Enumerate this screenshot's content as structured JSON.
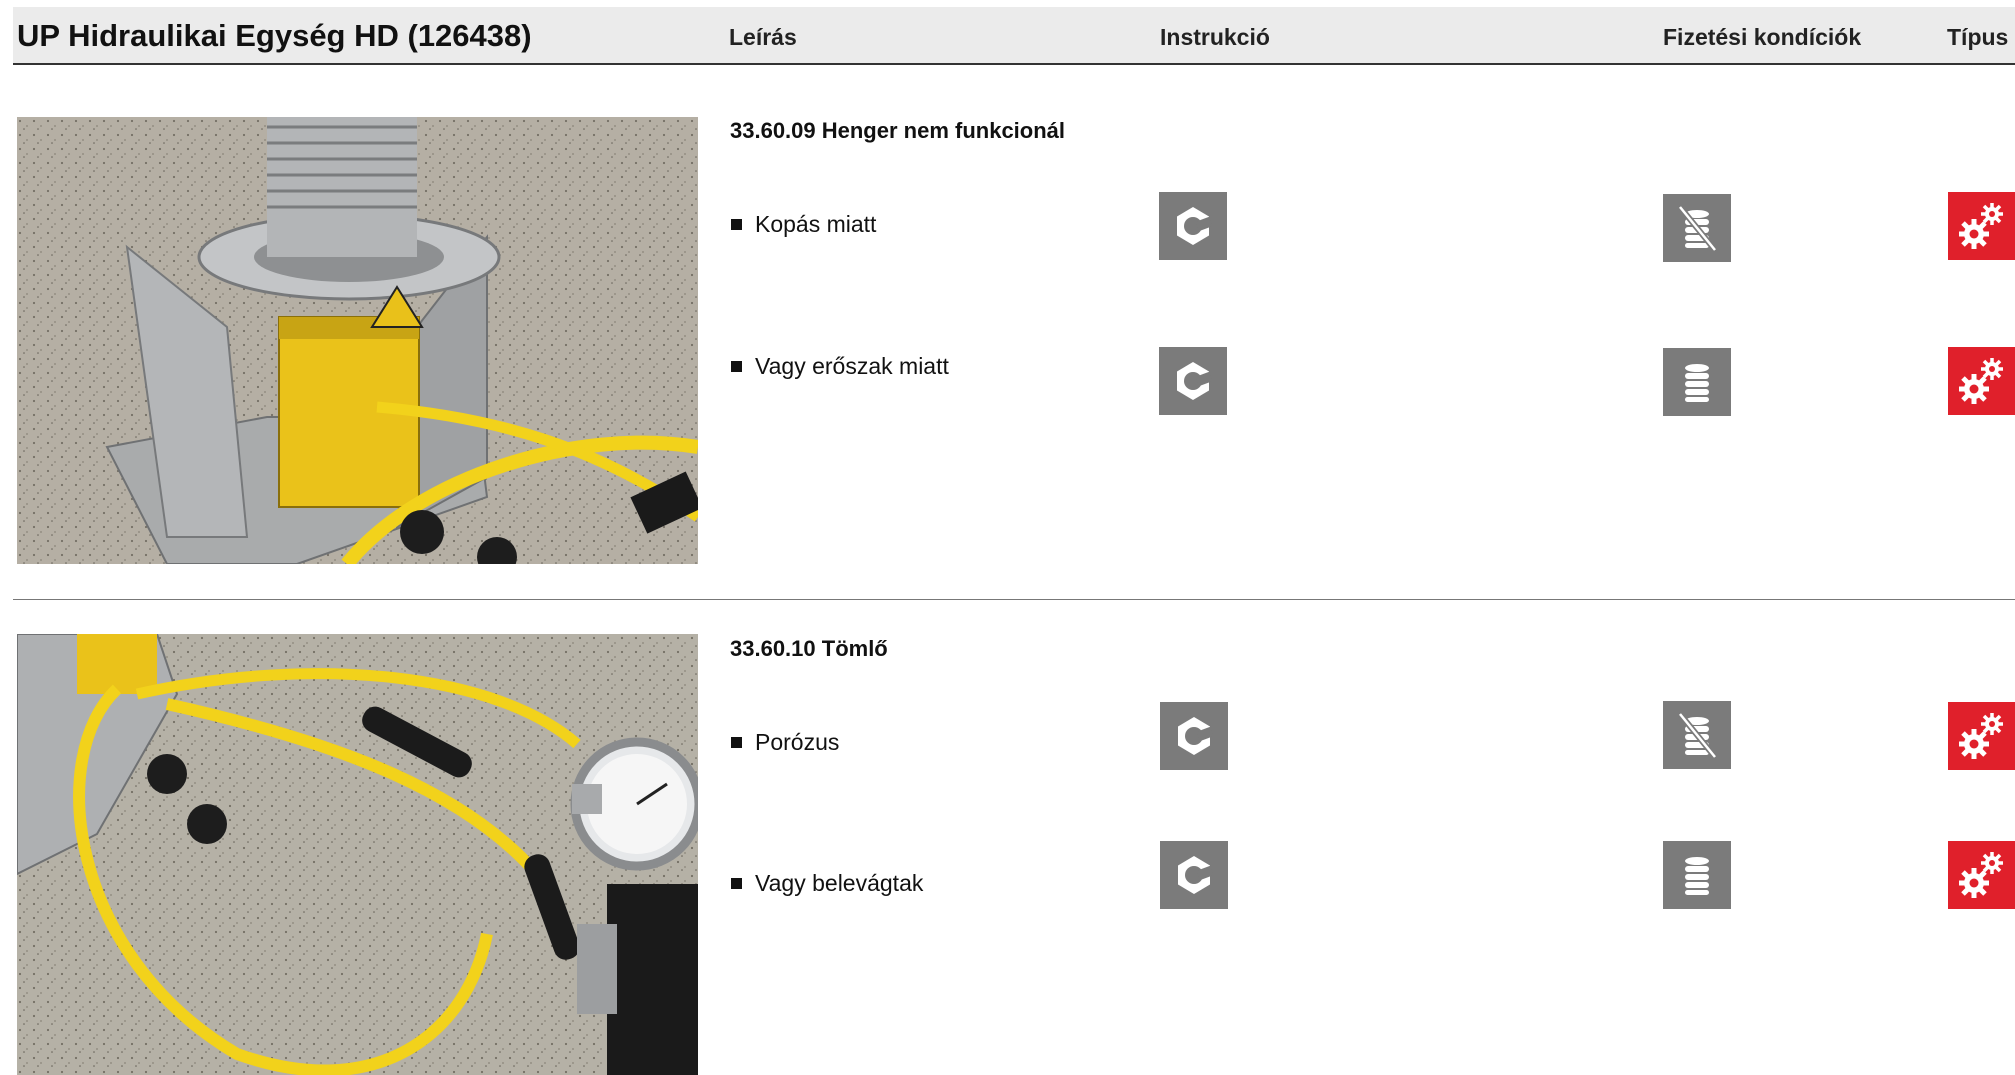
{
  "header": {
    "title": "UP Hidraulikai Egység HD (126438)",
    "col_description": "Leírás",
    "col_instruction": "Instrukció",
    "col_payment": "Fizetési kondíciók",
    "col_type": "Típus"
  },
  "sections": [
    {
      "title": "33.60.09 Henger nem funkcionál",
      "photo_icon": "hydraulic-cylinder-photo",
      "items": [
        {
          "label": "Kopás miatt",
          "instruction_icon": "hex-nut-icon",
          "payment_icon": "coins-crossed-icon",
          "type_icon": "gears-icon"
        },
        {
          "label": "Vagy erőszak miatt",
          "instruction_icon": "hex-nut-icon",
          "payment_icon": "coins-icon",
          "type_icon": "gears-icon"
        }
      ]
    },
    {
      "title": "33.60.10 Tömlő",
      "photo_icon": "hydraulic-hose-photo",
      "items": [
        {
          "label": "Porózus",
          "instruction_icon": "hex-nut-icon",
          "payment_icon": "coins-crossed-icon",
          "type_icon": "gears-icon"
        },
        {
          "label": "Vagy belevágtak",
          "instruction_icon": "hex-nut-icon",
          "payment_icon": "coins-icon",
          "type_icon": "gears-icon"
        }
      ]
    }
  ],
  "colors": {
    "header_bg": "#ebebeb",
    "icon_gray": "#7b7b7b",
    "icon_red": "#e0202b",
    "hose_yellow": "#f2d21b"
  }
}
